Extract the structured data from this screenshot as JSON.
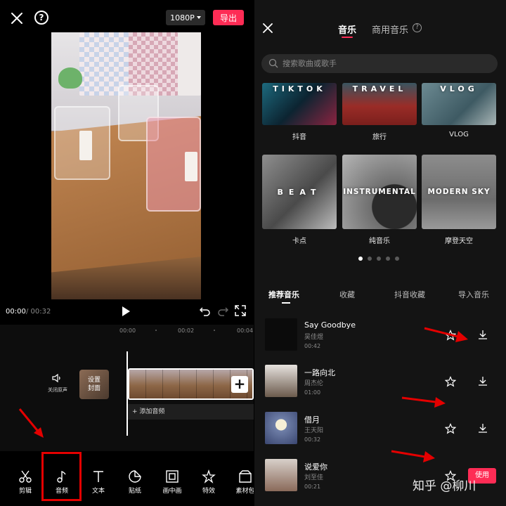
{
  "editor": {
    "resolution": "1080P",
    "export_label": "导出",
    "help_symbol": "?",
    "time_current": "00:00",
    "time_total": "/ 00:32",
    "ticks": [
      "00:00",
      "00:02",
      "00:04"
    ],
    "mute_label": "关闭原声",
    "cover_line1": "设置",
    "cover_line2": "封面",
    "add_symbol": "+",
    "add_audio_label": "+ 添加音频",
    "toolbar": [
      {
        "label": "剪辑",
        "icon": "scissors-icon"
      },
      {
        "label": "音频",
        "icon": "music-note-icon"
      },
      {
        "label": "文本",
        "icon": "text-icon"
      },
      {
        "label": "贴纸",
        "icon": "sticker-icon"
      },
      {
        "label": "画中画",
        "icon": "picture-in-picture-icon"
      },
      {
        "label": "特效",
        "icon": "effects-star-icon"
      },
      {
        "label": "素材包",
        "icon": "material-pack-icon"
      }
    ],
    "highlight_color": "#e40000",
    "accent_color": "#fe2c55"
  },
  "music": {
    "tab_music": "音乐",
    "tab_commercial": "商用音乐",
    "info_symbol": "?",
    "search_placeholder": "搜索歌曲或歌手",
    "categories": [
      {
        "word": "TIKTOK",
        "label": "抖音"
      },
      {
        "word": "TRAVEL",
        "label": "旅行"
      },
      {
        "word": "VLOG",
        "label": "VLOG"
      },
      {
        "word": "BEAT",
        "label": "卡点"
      },
      {
        "word": "INSTRUMENTAL",
        "label": "纯音乐"
      },
      {
        "word": "MODERN SKY",
        "label": "摩登天空"
      }
    ],
    "carousel_pages": 5,
    "carousel_active": 1,
    "subtabs": [
      "推荐音乐",
      "收藏",
      "抖音收藏",
      "导入音乐"
    ],
    "songs": [
      {
        "title": "Say Goodbye",
        "artist": "吴佳煜",
        "duration": "00:42"
      },
      {
        "title": "一路向北",
        "artist": "周杰伦",
        "duration": "01:00"
      },
      {
        "title": "借月",
        "artist": "王天阳",
        "duration": "00:32"
      },
      {
        "title": "说爱你",
        "artist": "刘至佳",
        "duration": "00:21"
      }
    ],
    "use_label": "使用"
  },
  "watermark": "知乎 @柳川"
}
